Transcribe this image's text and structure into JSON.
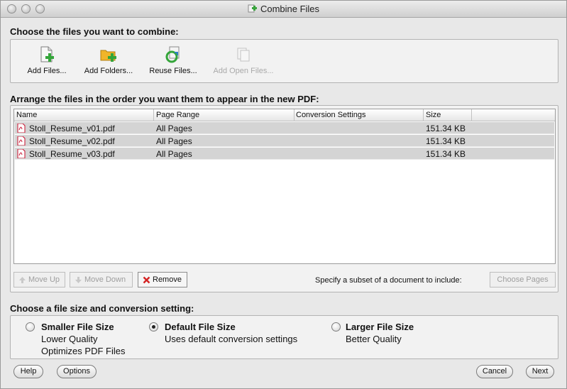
{
  "window": {
    "title": "Combine Files"
  },
  "sections": {
    "choose_files": "Choose the files you want to combine:",
    "arrange": "Arrange the files in the order you want them to appear in the new PDF:",
    "size_setting": "Choose a file size and conversion setting:"
  },
  "toolbar": {
    "add_files": "Add Files...",
    "add_folders": "Add Folders...",
    "reuse_files": "Reuse Files...",
    "add_open_files": "Add Open Files..."
  },
  "table": {
    "columns": [
      "Name",
      "Page Range",
      "Conversion Settings",
      "Size"
    ],
    "rows": [
      {
        "name": "Stoll_Resume_v01.pdf",
        "page_range": "All Pages",
        "conversion": "",
        "size": "151.34 KB"
      },
      {
        "name": "Stoll_Resume_v02.pdf",
        "page_range": "All Pages",
        "conversion": "",
        "size": "151.34 KB"
      },
      {
        "name": "Stoll_Resume_v03.pdf",
        "page_range": "All Pages",
        "conversion": "",
        "size": "151.34 KB"
      }
    ]
  },
  "list_actions": {
    "move_up": "Move Up",
    "move_down": "Move Down",
    "remove": "Remove",
    "subset_hint": "Specify a subset of a document to include:",
    "choose_pages": "Choose Pages"
  },
  "size_options": [
    {
      "title": "Smaller File Size",
      "lines": [
        "Lower Quality",
        "Optimizes PDF Files"
      ],
      "selected": false
    },
    {
      "title": "Default File Size",
      "lines": [
        "Uses default conversion settings"
      ],
      "selected": true
    },
    {
      "title": "Larger File Size",
      "lines": [
        "Better Quality"
      ],
      "selected": false
    }
  ],
  "footer": {
    "help": "Help",
    "options": "Options",
    "cancel": "Cancel",
    "next": "Next"
  },
  "colors": {
    "selected_row": "#d4d4d4",
    "pdf_red": "#c8102e",
    "add_green": "#34a53a",
    "folder_yellow": "#f0b52a"
  },
  "icons": {
    "add_files": "document-plus-icon",
    "add_folders": "folder-plus-icon",
    "reuse_files": "recycle-icon",
    "add_open_files": "open-documents-icon",
    "pdf": "pdf-file-icon",
    "move_up": "arrow-up-icon",
    "move_down": "arrow-down-icon",
    "remove": "red-x-icon"
  }
}
